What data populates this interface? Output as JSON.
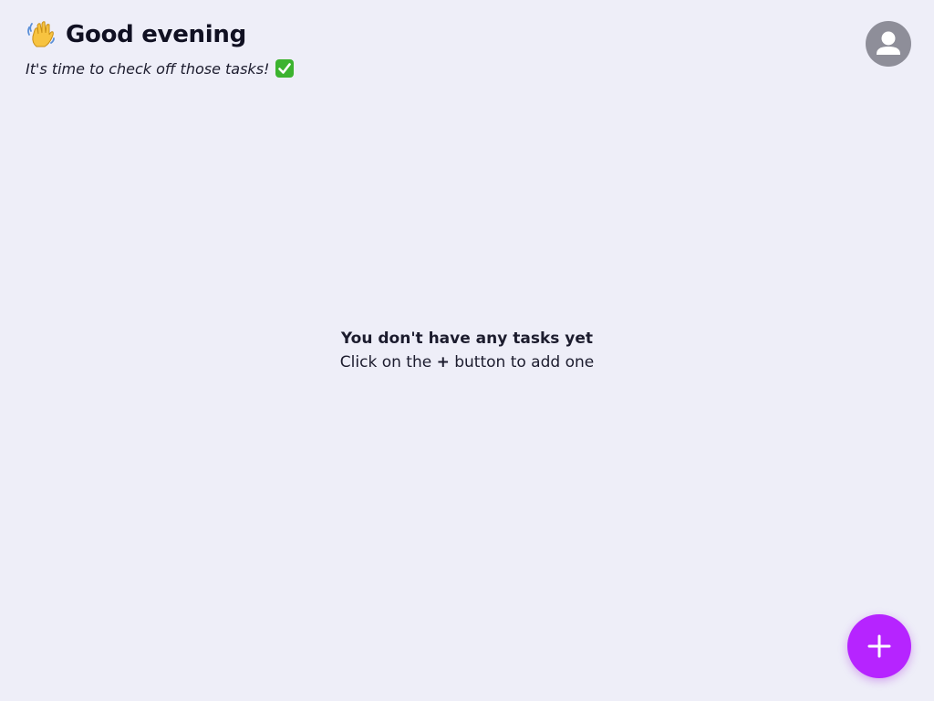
{
  "header": {
    "greeting": "Good evening",
    "subtitle": "It's time to check off those tasks!",
    "greeting_icon": "waving-hand-icon",
    "subtitle_icon": "check-mark-button-icon"
  },
  "empty_state": {
    "title": "You don't have any tasks yet",
    "hint_before": "Click on the ",
    "hint_symbol": "+",
    "hint_after": " button to add one"
  },
  "avatar": {
    "icon": "user-icon",
    "color": "#8e8e99"
  },
  "add_button": {
    "icon": "plus-icon",
    "color": "#b624ff"
  },
  "colors": {
    "background": "#eeeef8",
    "text": "#1c1c2e",
    "accent": "#b624ff"
  }
}
